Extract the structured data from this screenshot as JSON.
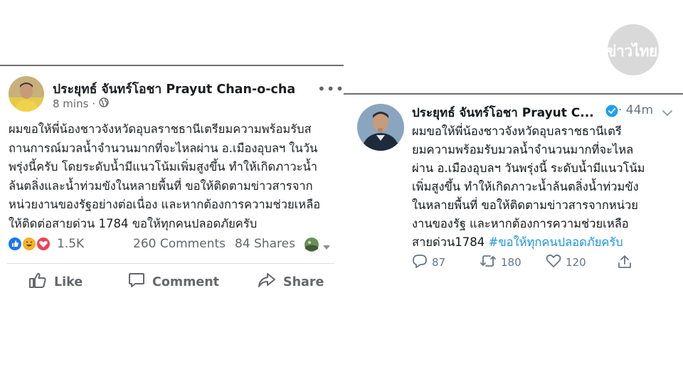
{
  "watermark": {
    "text": "สำนักข่าวไทย"
  },
  "facebook": {
    "author": "ประยุทธ์ จันทร์โอชา Prayut Chan-o-cha",
    "time": "8 mins",
    "separator": "·",
    "post_lines": [
      "ผมขอให้พี่น้องชาวจังหวัดอุบลราชธานีเตรียมความพร้อมรับส",
      "ถานการณ์มวลน้ำจำนวนมากที่จะไหลผ่าน  อ.เมืองอุบลฯ ในวัน",
      "พรุ่งนี้ครับ โดยระดับน้ำมีแนวโน้มเพิ่มสูงขึ้น ทำให้เกิดภาวะน้ำ",
      "ล้นตลิ่งและน้ำท่วมขังในหลายพื้นที่ ขอให้ติดตามข่าวสารจาก",
      "หน่วยงานของรัฐอย่างต่อเนื่อง และหากต้องการความช่วยเหลือ",
      "ให้ติดต่อสายด่วน 1784 ขอให้ทุกคนปลอดภัยครับ"
    ],
    "reactions_count": "1.5K",
    "comments": "260 Comments",
    "shares": "84 Shares",
    "actions": {
      "like": "Like",
      "comment": "Comment",
      "share": "Share"
    },
    "colors": {
      "like": "#1877f2",
      "haha": "#f7b125",
      "love": "#f33e58",
      "meta": "#65676b"
    }
  },
  "twitter": {
    "author": "ประยุทธ์ จันทร์โอชา Prayut C...",
    "time": "· 44m",
    "body_lines": [
      "ผมขอให้พี่น้องชาวจังหวัดอุบลราชธานีเตรี",
      "ยมความพร้อมรับมวลน้ำจำนวนมากที่จะไหล",
      "ผ่าน  อ.เมืองอุบลฯ วันพรุ่งนี้ ระดับน้ำมีแนวโน้ม",
      "เพิ่มสูงขึ้น ทำให้เกิดภาวะน้ำล้นตลิ่งน้ำท่วมขัง",
      "ในหลายพื้นที่ ขอให้ติดตามข่าวสารจากหน่วย",
      "งานของรัฐ และหากต้องการความช่วยเหลือ"
    ],
    "last_line_text": "สายด่วน1784 ",
    "hashtag": "#ขอให้ทุกคนปลอดภัยครับ",
    "replies": "87",
    "retweets": "180",
    "likes": "120",
    "colors": {
      "verified": "#1da1f2",
      "hashtag": "#1b95e0",
      "meta": "#657786"
    }
  }
}
